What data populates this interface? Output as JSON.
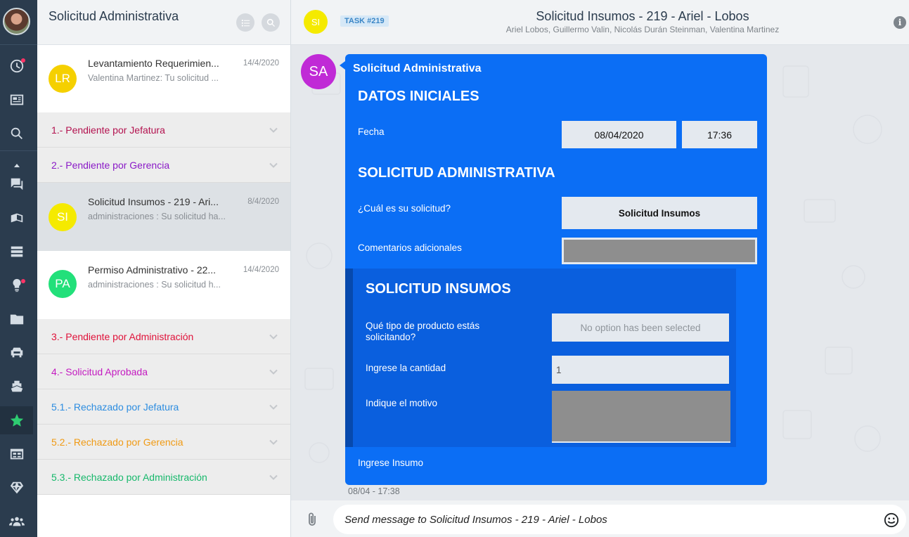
{
  "sidebar": {
    "title": "Solicitud Administrativa",
    "chats": [
      {
        "initials": "LR",
        "color": "#f5d000",
        "name": "Levantamiento Requerimien...",
        "snippet": "Valentina Martinez: Tu solicitud ...",
        "date": "14/4/2020"
      },
      {
        "initials": "SI",
        "color": "#f5ea00",
        "name": "Solicitud Insumos - 219 - Ari...",
        "snippet": "administraciones : Su solicitud ha...",
        "date": "8/4/2020"
      },
      {
        "initials": "PA",
        "color": "#22e07a",
        "name": "Permiso Administrativo - 22...",
        "snippet": "administraciones : Su solicitud h...",
        "date": "14/4/2020"
      }
    ],
    "groups": [
      {
        "label": "1.- Pendiente por Jefatura",
        "color": "#b3124f"
      },
      {
        "label": "2.- Pendiente por Gerencia",
        "color": "#8a1ac7"
      },
      {
        "label": "3.- Pendiente por Administración",
        "color": "#e0123a"
      },
      {
        "label": "4.- Solicitud Aprobada",
        "color": "#c31ac0"
      },
      {
        "label": "5.1.- Rechazado por Jefatura",
        "color": "#2d8de0"
      },
      {
        "label": "5.2.- Rechazado por Gerencia",
        "color": "#f09a14"
      },
      {
        "label": "5.3.- Rechazado por Administración",
        "color": "#16b86b"
      }
    ]
  },
  "topbar": {
    "initials": "SI",
    "task_badge": "TASK #219",
    "title": "Solicitud Insumos - 219 - Ariel - Lobos",
    "participants": "Ariel Lobos, Guillermo Valin, Nicolás Durán Steinman, Valentina Martinez",
    "info_icon": "i"
  },
  "message": {
    "sender_initials": "SA",
    "sender": "Solicitud Administrativa",
    "section1": "DATOS INICIALES",
    "fecha_label": "Fecha",
    "fecha_value": "08/04/2020",
    "hora_value": "17:36",
    "section2": "SOLICITUD ADMINISTRATIVA",
    "solicitud_label": "¿Cuál es su solicitud?",
    "solicitud_value": "Solicitud Insumos",
    "comentarios_label": "Comentarios adicionales",
    "section3": "SOLICITUD INSUMOS",
    "tipo_label": "Qué tipo de producto estás solicitando?",
    "tipo_placeholder": "No option has been selected",
    "cantidad_label": "Ingrese la cantidad",
    "cantidad_value": "1",
    "motivo_label": "Indique el motivo",
    "insumo_label": "Ingrese Insumo",
    "timestamp": "08/04 - 17:38"
  },
  "composer": {
    "placeholder": "Send message to Solicitud Insumos - 219 - Ariel - Lobos"
  },
  "colors": {
    "rail": "#2b3c4e",
    "bubble": "#0b6ef5",
    "active_icon": "#2ecc71"
  }
}
